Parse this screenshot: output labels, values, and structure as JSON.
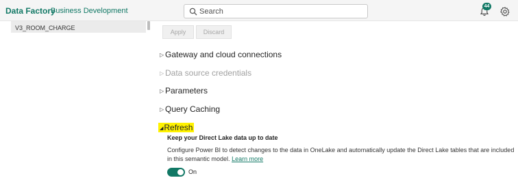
{
  "header": {
    "app_title": "Data Factory",
    "workspace": "Business Development",
    "search_placeholder": "Search",
    "notification_count": "44",
    "accent": "#117865"
  },
  "left_pane": {
    "selected_item": "V3_ROOM_CHARGE"
  },
  "actions": {
    "apply_label": "Apply",
    "discard_label": "Discard"
  },
  "sections": [
    {
      "label": "Gateway and cloud connections",
      "expanded": false,
      "disabled": false
    },
    {
      "label": "Data source credentials",
      "expanded": false,
      "disabled": true
    },
    {
      "label": "Parameters",
      "expanded": false,
      "disabled": false
    },
    {
      "label": "Query Caching",
      "expanded": false,
      "disabled": false
    },
    {
      "label": "Refresh",
      "expanded": true,
      "highlighted": true,
      "highlight_color": "#fff200"
    }
  ],
  "refresh": {
    "heading": "Keep your Direct Lake data up to date",
    "description": "Configure Power BI to detect changes to the data in OneLake and automatically update the Direct Lake tables that are included in this semantic model.",
    "learn_more": "Learn more",
    "toggle_state": "On",
    "toggle_on": true
  },
  "icons": [
    "search-icon",
    "bell-icon",
    "gear-icon",
    "caret-right-icon",
    "caret-down-icon"
  ]
}
